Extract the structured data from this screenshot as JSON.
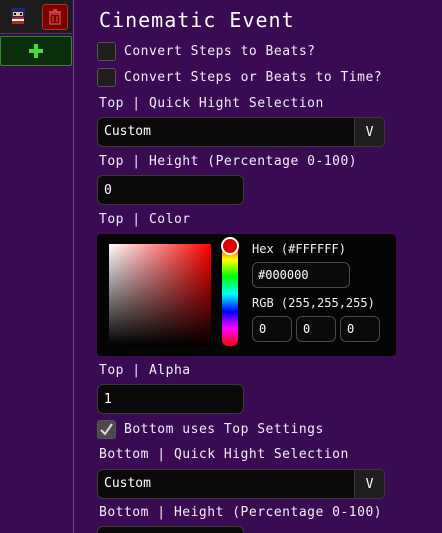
{
  "sidebar": {
    "add_label": "+",
    "delete_icon": "trash-icon",
    "thumbnail_icon": "character-icon"
  },
  "panel": {
    "title": "Cinematic Event",
    "convert_steps_to_beats": {
      "label": "Convert Steps to Beats?",
      "checked": false
    },
    "convert_to_time": {
      "label": "Convert Steps or Beats to Time?",
      "checked": false
    },
    "top_quick_height_label": "Top | Quick Hight Selection",
    "top_quick_height_value": "Custom",
    "top_height_label": "Top | Height (Percentage 0-100)",
    "top_height_value": "0",
    "top_color_label": "Top | Color",
    "top_alpha_label": "Top | Alpha",
    "top_alpha_value": "1",
    "bottom_uses_top": {
      "label": "Bottom uses Top Settings",
      "checked": true
    },
    "bottom_quick_height_label": "Bottom | Quick Hight Selection",
    "bottom_quick_height_value": "Custom",
    "bottom_height_label": "Bottom | Height (Percentage 0-100)",
    "select_arrow": "V"
  },
  "color_picker": {
    "hex_label": "Hex (#FFFFFF)",
    "hex_value": "#000000",
    "rgb_label": "RGB (255,255,255)",
    "r": "0",
    "g": "0",
    "b": "0",
    "hue_color": "#ff0000"
  },
  "colors": {
    "background": "#3a0a52",
    "add_button": "#2f8a2f",
    "delete_button": "#7a0000"
  }
}
